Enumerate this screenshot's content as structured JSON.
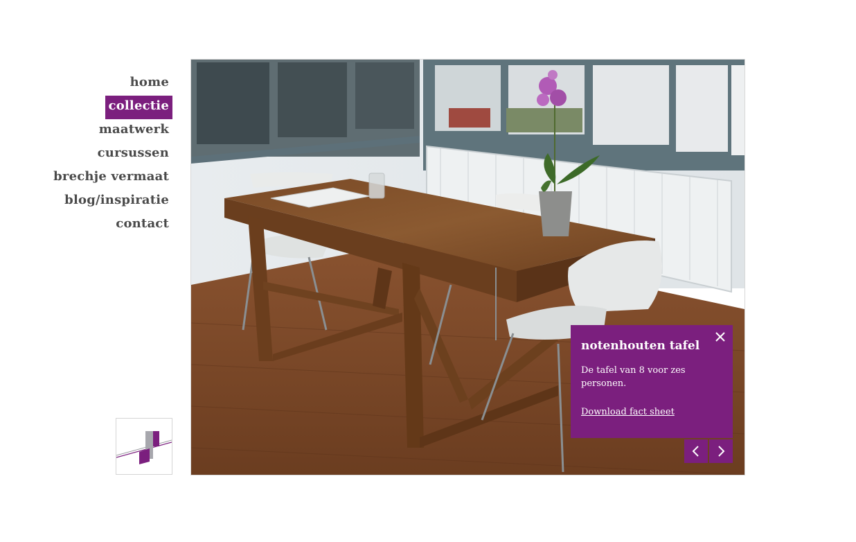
{
  "nav": {
    "items": [
      {
        "label": "home"
      },
      {
        "label": "collectie"
      },
      {
        "label": "maatwerk"
      },
      {
        "label": "cursussen"
      },
      {
        "label": "brechje vermaat"
      },
      {
        "label": "blog/inspiratie"
      },
      {
        "label": "contact"
      }
    ],
    "active": "collectie"
  },
  "photo": {
    "subject": "walnut dining table with white chairs and orchid"
  },
  "info": {
    "title": "notenhouten tafel",
    "description": "De tafel van 8 voor zes personen.",
    "link_label": "Download fact sheet"
  },
  "icons": {
    "close": "close-icon",
    "prev": "chevron-left-icon",
    "next": "chevron-right-icon"
  },
  "colors": {
    "accent": "#7b1f7e",
    "nav_text": "#4a4a4a"
  }
}
